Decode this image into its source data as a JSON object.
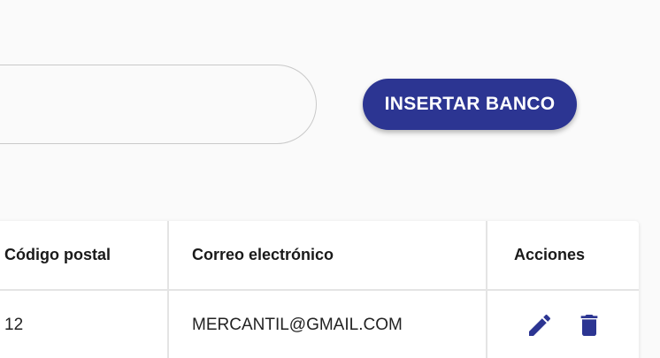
{
  "search": {
    "value": "",
    "placeholder": ""
  },
  "toolbar": {
    "insert_label": "INSERTAR BANCO"
  },
  "table": {
    "columns": [
      "Código postal",
      "Correo electrónico",
      "Acciones"
    ],
    "rows": [
      {
        "postal_code": "12",
        "email": "MERCANTIL@GMAIL.COM",
        "actions": [
          "edit-icon",
          "trash-icon"
        ]
      }
    ]
  },
  "colors": {
    "accent": "#2c3592",
    "border": "#e4e4e4",
    "background": "#fafafa"
  }
}
